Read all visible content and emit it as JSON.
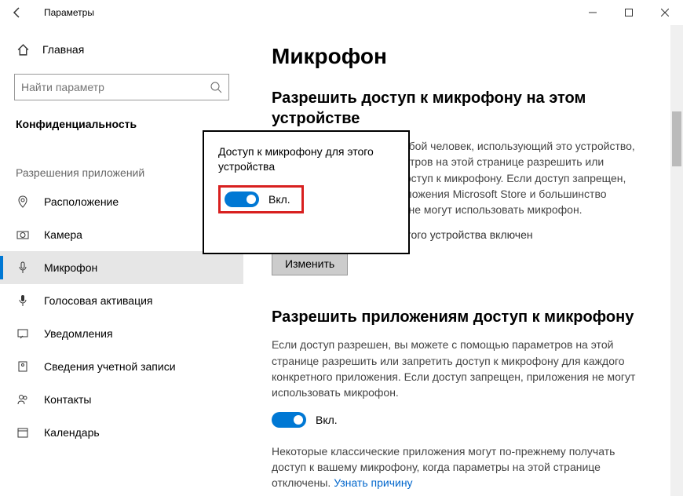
{
  "window": {
    "title": "Параметры"
  },
  "sidebar": {
    "home": "Главная",
    "searchPlaceholder": "Найти параметр",
    "category": "Конфиденциальность",
    "sectionLabel": "Разрешения приложений",
    "items": [
      {
        "label": "Расположение"
      },
      {
        "label": "Камера"
      },
      {
        "label": "Микрофон"
      },
      {
        "label": "Голосовая активация"
      },
      {
        "label": "Уведомления"
      },
      {
        "label": "Сведения учетной записи"
      },
      {
        "label": "Контакты"
      },
      {
        "label": "Календарь"
      }
    ]
  },
  "main": {
    "title": "Микрофон",
    "section1": {
      "heading": "Разрешить доступ к микрофону на этом устройстве",
      "body": "Если доступ разрешен, любой человек, использующий это устройство, сможет с помощью параметров на этой странице разрешить или запретить приложениям доступ к микрофону. Если доступ запрещен, компоненты Windows, приложения Microsoft Store и большинство классических приложений не могут использовать микрофон.",
      "status": "Доступ к микрофону для этого устройства включен",
      "changeBtn": "Изменить"
    },
    "section2": {
      "heading": "Разрешить приложениям доступ к микрофону",
      "body": "Если доступ разрешен, вы можете с помощью параметров на этой странице разрешить или запретить доступ к микрофону для каждого конкретного приложения. Если доступ запрещен, приложения не могут использовать микрофон.",
      "toggleLabel": "Вкл.",
      "footer": "Некоторые классические приложения могут по-прежнему получать доступ к вашему микрофону, когда параметры на этой странице отключены. ",
      "footerLink": "Узнать причину"
    }
  },
  "popup": {
    "title": "Доступ к микрофону для этого устройства",
    "toggleLabel": "Вкл."
  }
}
